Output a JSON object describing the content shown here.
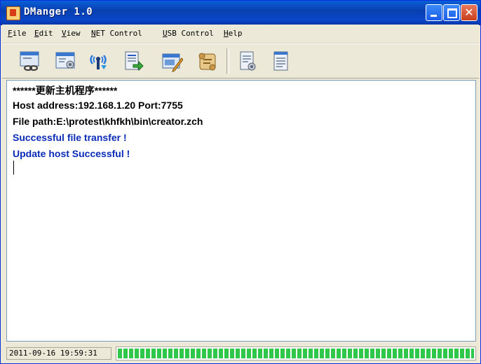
{
  "window": {
    "title": "DManger 1.0"
  },
  "menu": {
    "items": [
      {
        "accel": "F",
        "rest": "ile"
      },
      {
        "accel": "E",
        "rest": "dit"
      },
      {
        "accel": "V",
        "rest": "iew"
      },
      {
        "accel": "N",
        "rest": "ET Control"
      },
      {
        "accel": "U",
        "rest": "SB Control"
      },
      {
        "accel": "H",
        "rest": "elp"
      }
    ]
  },
  "toolbar": {
    "icons": [
      "connect-icon",
      "settings-window-icon",
      "wireless-icon",
      "file-send-icon",
      "edit-window-icon",
      "scroll-icon",
      "file-settings-icon",
      "file-list-icon"
    ]
  },
  "log": {
    "lines": [
      "******更新主机程序******",
      "Host address:192.168.1.20 Port:7755",
      "File path:E:\\protest\\khfkh\\bin\\creator.zch",
      "Successful file transfer !",
      "Update host Successful !"
    ]
  },
  "status": {
    "timestamp": "2011-09-16 19:59:31",
    "progress": 1.0
  },
  "colors": {
    "titlebar": "#0840b0",
    "success_text": "#0a2bb8",
    "progress": "#2fc84a"
  }
}
